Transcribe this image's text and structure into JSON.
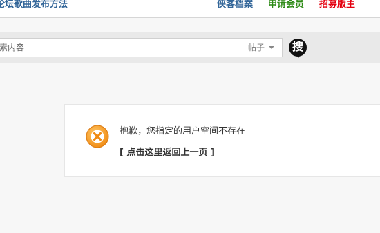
{
  "nav": {
    "title": "论坛歌曲发布方法",
    "archive": "侠客档案",
    "apply": "申请会员",
    "recruit": "招募版主"
  },
  "search": {
    "placeholder": "素内容",
    "type_label": "帖子",
    "button_glyph": "搜"
  },
  "message": {
    "text": "抱歉，您指定的用户空间不存在",
    "back_link": "[ 点击这里返回上一页 ]"
  },
  "colors": {
    "nav_blue": "#336699",
    "nav_green": "#2d8a16",
    "nav_red": "#e4000f",
    "error_orange": "#f39a1f"
  }
}
